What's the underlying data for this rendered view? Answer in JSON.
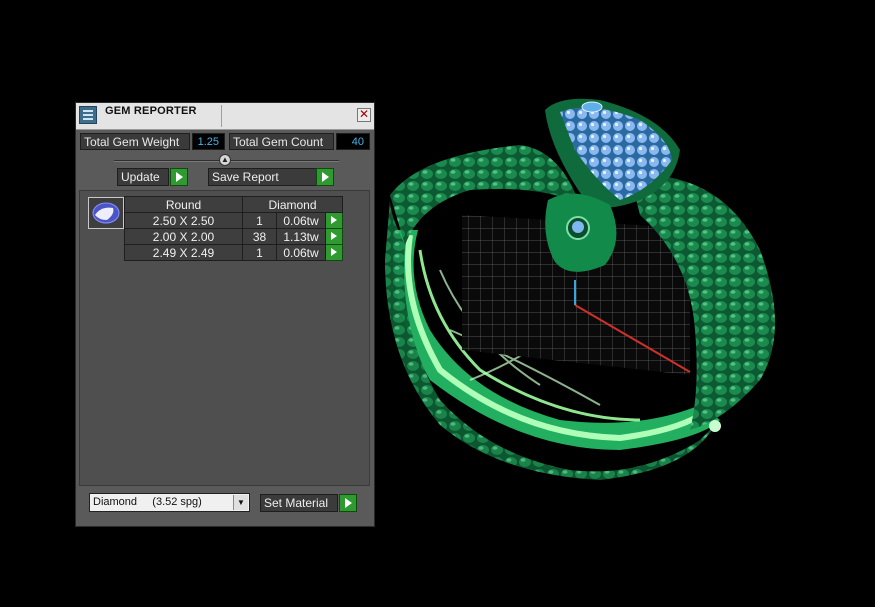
{
  "panel": {
    "title": "GEM REPORTER",
    "close_glyph": "✕",
    "stats": {
      "weight_label": "Total Gem Weight",
      "weight_value": "1.25",
      "count_label": "Total Gem Count",
      "count_value": "40"
    },
    "collapse_glyph": "▲",
    "buttons": {
      "update_label": "Update",
      "save_label": "Save Report"
    },
    "gem_table": {
      "shape_header": "Round",
      "material_header": "Diamond",
      "rows": [
        {
          "size": "2.50 X 2.50",
          "count": "1",
          "weight": "0.06tw"
        },
        {
          "size": "2.00 X 2.00",
          "count": "38",
          "weight": "1.13tw"
        },
        {
          "size": "2.49 X 2.49",
          "count": "1",
          "weight": "0.06tw"
        }
      ]
    },
    "material_select": {
      "value": "Diamond     (3.52 spg)",
      "arrow_glyph": "▼"
    },
    "set_material_label": "Set Material"
  },
  "icons": {
    "app": "gem-reporter-app-icon",
    "close": "close-icon",
    "collapse": "collapse-icon",
    "play": "play-arrow-icon",
    "gem": "round-gem-icon",
    "dropdown": "chevron-down-icon"
  },
  "colors": {
    "accent_green": "#2f9a2f",
    "value_blue": "#46b4e8",
    "panel_gray": "#5a5a5a",
    "background": "#000000",
    "model_green": "#0f6b3c",
    "gem_blue": "#8ab8f0"
  }
}
